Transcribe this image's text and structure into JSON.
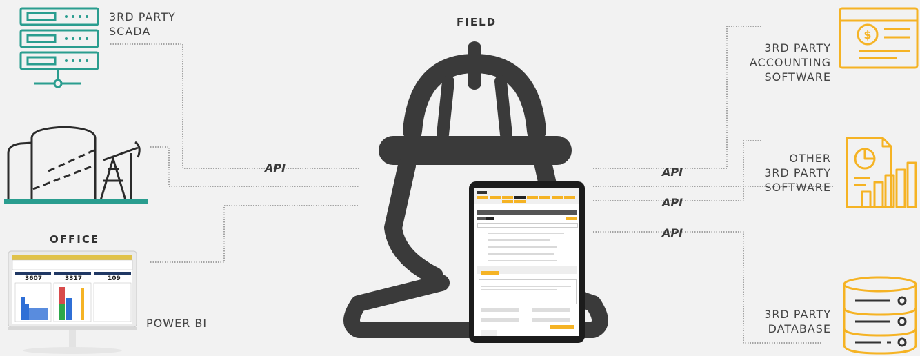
{
  "center": {
    "title": "FIELD"
  },
  "office": {
    "title": "OFFICE",
    "powerbi_label": "POWER BI",
    "dashboard_numbers": [
      "3607",
      "3317",
      "109"
    ]
  },
  "left_nodes": {
    "scada": {
      "line1": "3RD PARTY",
      "line2": "SCADA"
    }
  },
  "right_nodes": {
    "accounting": {
      "line1": "3RD PARTY",
      "line2": "ACCOUNTING",
      "line3": "SOFTWARE"
    },
    "other": {
      "line1": "OTHER",
      "line2": "3RD PARTY",
      "line3": "SOFTWARE"
    },
    "database": {
      "line1": "3RD PARTY",
      "line2": "DATABASE"
    }
  },
  "api_labels": [
    "API",
    "API",
    "API",
    "API"
  ],
  "colors": {
    "accent": "#f5b324",
    "teal": "#2a9d8f",
    "dark": "#3a3a3a",
    "background": "#f2f2f2"
  },
  "icons": [
    "server-rack-icon",
    "oil-field-icon",
    "monitor-icon",
    "hard-hat-icon",
    "tablet-icon",
    "accounting-document-icon",
    "report-chart-icon",
    "database-icon"
  ]
}
